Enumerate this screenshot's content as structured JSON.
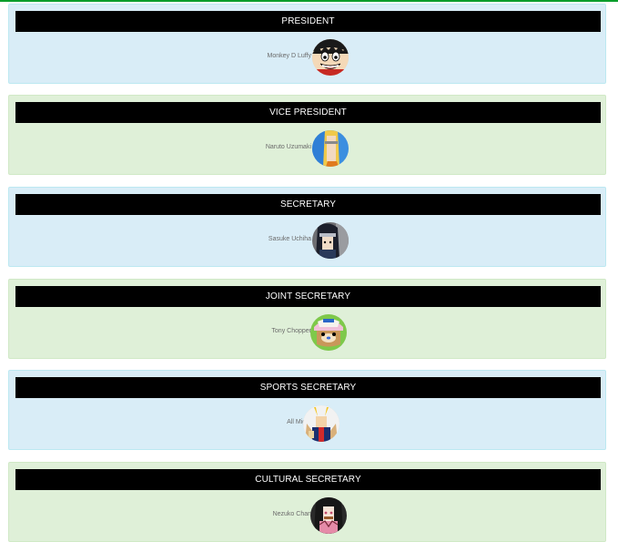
{
  "accent_color": "#0a9d2b",
  "panel_colors": {
    "blue": "#d9edf7",
    "green": "#dff0d8"
  },
  "positions": [
    {
      "title": "PRESIDENT",
      "member": "Monkey D Luffy",
      "avatar_icon": "luffy-avatar-icon",
      "theme": "blue"
    },
    {
      "title": "VICE PRESIDENT",
      "member": "Naruto Uzumaki",
      "avatar_icon": "naruto-avatar-icon",
      "theme": "green"
    },
    {
      "title": "SECRETARY",
      "member": "Sasuke Uchiha",
      "avatar_icon": "sasuke-avatar-icon",
      "theme": "blue"
    },
    {
      "title": "JOINT SECRETARY",
      "member": "Tony Chopper",
      "avatar_icon": "chopper-avatar-icon",
      "theme": "green"
    },
    {
      "title": "SPORTS SECRETARY",
      "member": "All Might",
      "avatar_icon": "all-might-avatar-icon",
      "theme": "blue"
    },
    {
      "title": "CULTURAL SECRETARY",
      "member": "Nezuko Chan",
      "avatar_icon": "nezuko-avatar-icon",
      "theme": "green"
    }
  ]
}
